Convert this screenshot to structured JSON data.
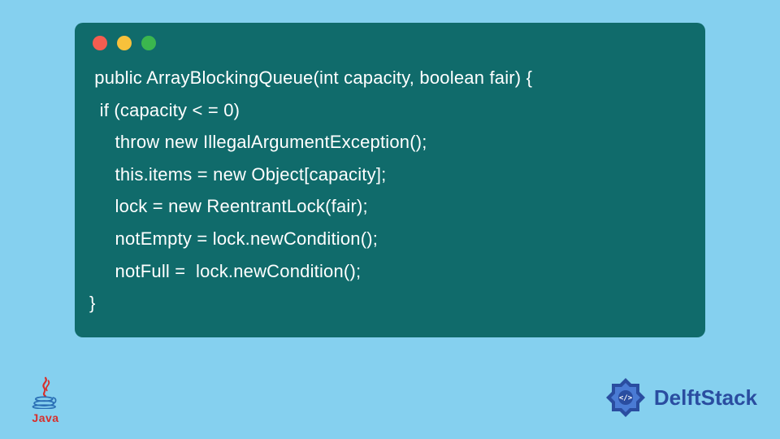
{
  "code": {
    "lines": [
      " public ArrayBlockingQueue(int capacity, boolean fair) {",
      "  if (capacity < = 0)",
      "     throw new IllegalArgumentException();",
      "     this.items = new Object[capacity];",
      "     lock = new ReentrantLock(fair);",
      "     notEmpty = lock.newCondition();",
      "     notFull =  lock.newCondition();",
      "}"
    ]
  },
  "logos": {
    "java_label": "Java",
    "delft_label": "DelftStack"
  },
  "colors": {
    "background": "#85d0ef",
    "window": "#106b6b",
    "code_text": "#ffffff",
    "java_red": "#d72f2b",
    "delft_blue": "#2a4da0"
  }
}
